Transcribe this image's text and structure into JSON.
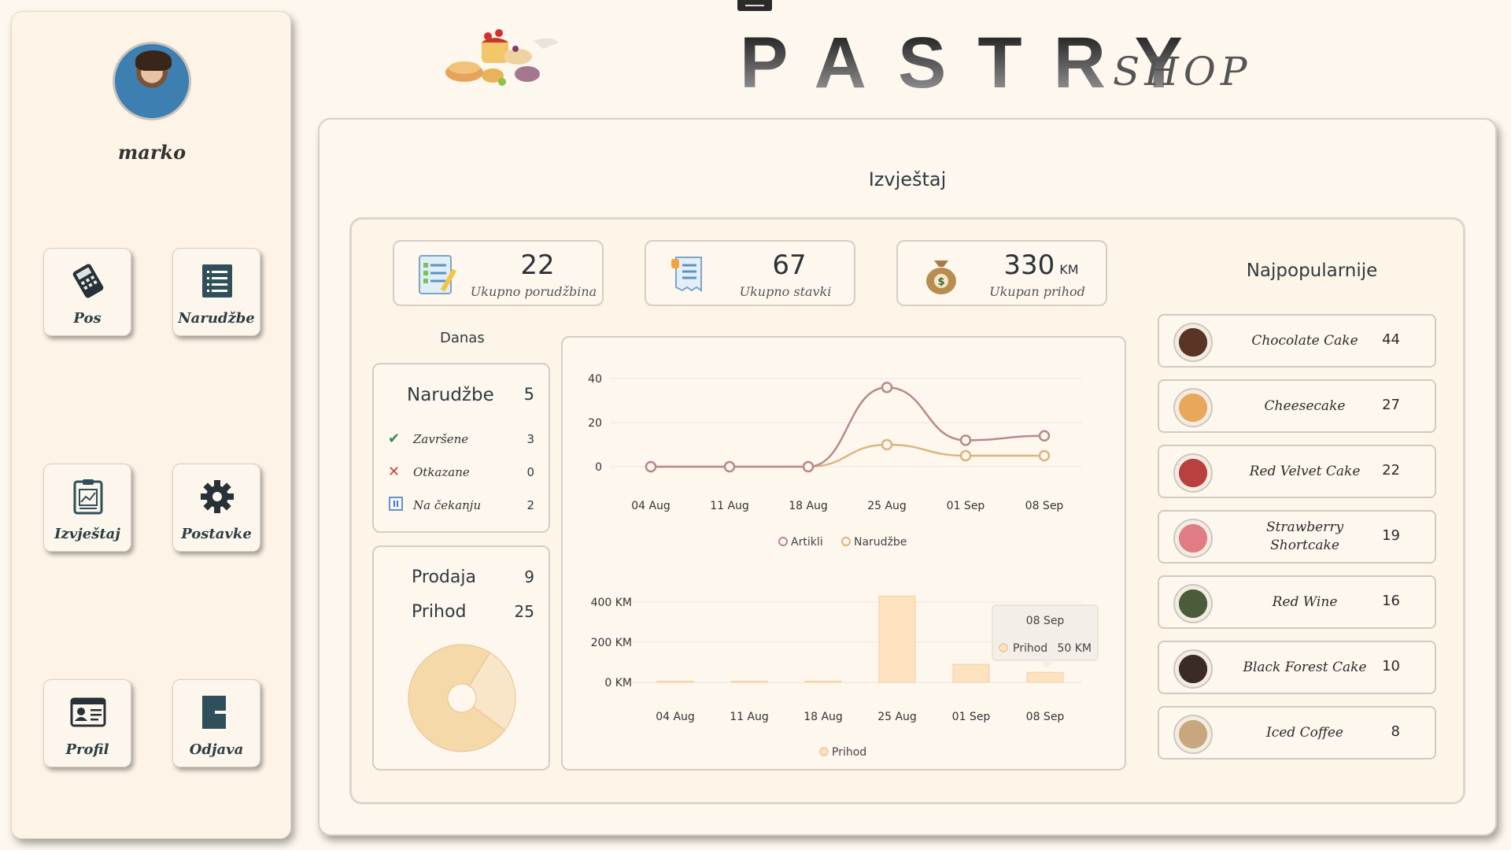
{
  "app": {
    "brand": "PASTRY",
    "brand_sub": "SHOP"
  },
  "user": {
    "name": "marko"
  },
  "nav": [
    {
      "label": "Pos",
      "icon": "card-terminal-icon"
    },
    {
      "label": "Narudžbe",
      "icon": "list-icon"
    },
    {
      "label": "Izvještaj",
      "icon": "report-icon"
    },
    {
      "label": "Postavke",
      "icon": "gear-icon"
    },
    {
      "label": "Profil",
      "icon": "id-card-icon"
    },
    {
      "label": "Odjava",
      "icon": "logout-icon"
    }
  ],
  "report": {
    "title": "Izvještaj",
    "stats": [
      {
        "value": "22",
        "unit": "",
        "caption": "Ukupno porudžbina",
        "icon": "checklist-icon"
      },
      {
        "value": "67",
        "unit": "",
        "caption": "Ukupno stavki",
        "icon": "receipt-icon"
      },
      {
        "value": "330",
        "unit": "KM",
        "caption": "Ukupan prihod",
        "icon": "money-bag-icon"
      }
    ],
    "today": {
      "label": "Danas",
      "orders_label": "Narudžbe",
      "orders_total": "5",
      "rows": [
        {
          "label": "Završene",
          "value": "3",
          "icon": "check-icon",
          "color": "#2e8b57"
        },
        {
          "label": "Otkazane",
          "value": "0",
          "icon": "cross-icon",
          "color": "#d23b3b"
        },
        {
          "label": "Na čekanju",
          "value": "2",
          "icon": "pause-icon",
          "color": "#3a7bd5"
        }
      ],
      "sales_label": "Prodaja",
      "sales_value": "9",
      "revenue_label": "Prihod",
      "revenue_value": "25"
    },
    "popular_title": "Najpopularnije",
    "popular": [
      {
        "name": "Chocolate Cake",
        "count": "44",
        "color": "#5a3424"
      },
      {
        "name": "Cheesecake",
        "count": "27",
        "color": "#e8a85a"
      },
      {
        "name": "Red Velvet Cake",
        "count": "22",
        "color": "#b8413f"
      },
      {
        "name": "Strawberry Shortcake",
        "count": "19",
        "color": "#e07c84"
      },
      {
        "name": "Red Wine",
        "count": "16",
        "color": "#4a5c3a"
      },
      {
        "name": "Black Forest Cake",
        "count": "10",
        "color": "#3b2a26"
      },
      {
        "name": "Iced Coffee",
        "count": "8",
        "color": "#c9a77e"
      }
    ]
  },
  "chart_data": [
    {
      "type": "line",
      "categories": [
        "04 Aug",
        "11 Aug",
        "18 Aug",
        "25 Aug",
        "01 Sep",
        "08 Sep"
      ],
      "series": [
        {
          "name": "Artikli",
          "values": [
            0,
            0,
            0,
            36,
            12,
            14
          ],
          "color": "#b88a8a"
        },
        {
          "name": "Narudžbe",
          "values": [
            0,
            0,
            0,
            10,
            5,
            5
          ],
          "color": "#dbb57f"
        }
      ],
      "yticks": [
        "0",
        "20",
        "40"
      ],
      "ylim": [
        0,
        40
      ],
      "legend": "bottom"
    },
    {
      "type": "bar",
      "categories": [
        "04 Aug",
        "11 Aug",
        "18 Aug",
        "25 Aug",
        "01 Sep",
        "08 Sep"
      ],
      "series": [
        {
          "name": "Prihod",
          "values": [
            0,
            0,
            0,
            430,
            90,
            50
          ],
          "color": "#fde2c0"
        }
      ],
      "yticks": [
        "0 KM",
        "200 KM",
        "400 KM"
      ],
      "ylim": [
        0,
        400
      ],
      "legend": "bottom",
      "tooltip": {
        "title": "08 Sep",
        "label": "Prihod",
        "value": "50 KM"
      }
    }
  ],
  "donut_data": {
    "values": [
      9,
      25
    ],
    "colors": [
      "#fbe5c8",
      "#f5d9a8"
    ]
  }
}
